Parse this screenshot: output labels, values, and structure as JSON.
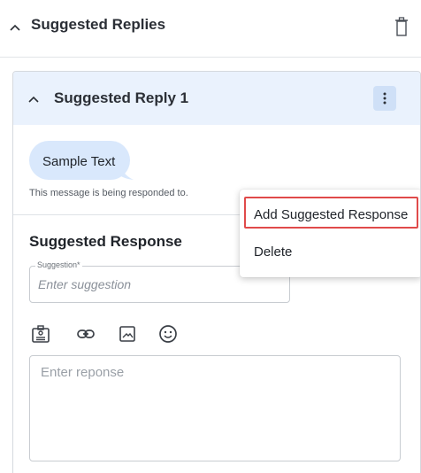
{
  "section": {
    "title": "Suggested Replies",
    "chevron_icon": "chevron-up-icon",
    "delete_icon": "trash-icon"
  },
  "card": {
    "title": "Suggested Reply 1",
    "chevron_icon": "chevron-up-icon",
    "menu_icon": "kebab-icon"
  },
  "message": {
    "text": "Sample Text",
    "caption": "This message is being responded to."
  },
  "response": {
    "title": "Suggested Response",
    "menu_icon": "kebab-icon",
    "field_label": "Suggestion*",
    "field_placeholder": "Enter suggestion",
    "field_value": "",
    "toolbar": [
      "contact-card-icon",
      "link-icon",
      "image-icon",
      "emoji-icon"
    ],
    "editor_placeholder": "Enter reponse",
    "editor_value": ""
  },
  "menu": {
    "items": [
      {
        "label": "Add Suggested Response",
        "highlighted": true
      },
      {
        "label": "Delete",
        "highlighted": false
      }
    ]
  },
  "colors": {
    "header_bg": "#eaf2fd",
    "bubble_bg": "#d9e8fc",
    "highlight_border": "#e04a4a"
  }
}
